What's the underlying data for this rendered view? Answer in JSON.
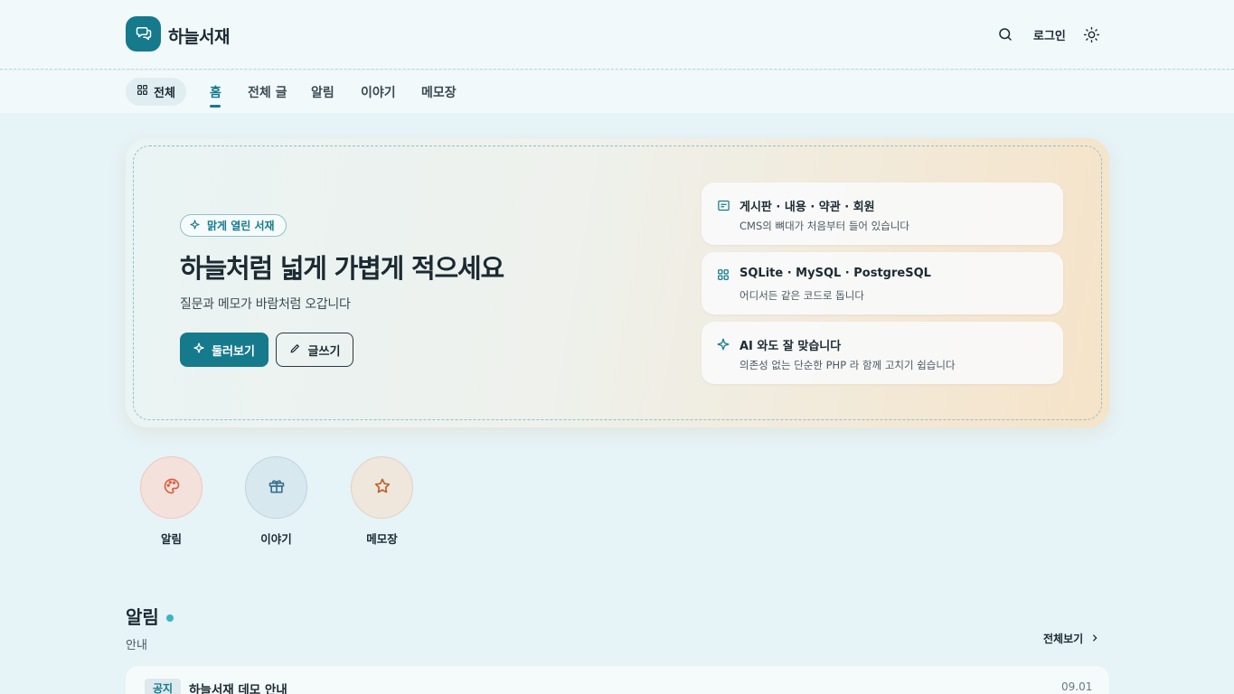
{
  "header": {
    "brand": "하늘서재",
    "login_label": "로그인",
    "icons": {
      "logo": "chat-bubble-icon",
      "search": "search-icon",
      "theme": "sun-icon"
    }
  },
  "nav": {
    "all_label": "전체",
    "items": [
      {
        "label": "홈",
        "active": true
      },
      {
        "label": "전체 글"
      },
      {
        "label": "알림"
      },
      {
        "label": "이야기"
      },
      {
        "label": "메모장"
      }
    ]
  },
  "hero": {
    "tag": "맑게 열린 서재",
    "title": "하늘처럼 넓게 가볍게 적으세요",
    "subtitle": "질문과 메모가 바람처럼 오갑니다",
    "primary_button": "둘러보기",
    "secondary_button": "글쓰기",
    "features": [
      {
        "icon": "board-icon",
        "title": "게시판 · 내용 · 약관 · 회원",
        "desc": "CMS의 뼈대가 처음부터 들어 있습니다"
      },
      {
        "icon": "grid-icon",
        "title": "SQLite · MySQL · PostgreSQL",
        "desc": "어디서든 같은 코드로 돕니다"
      },
      {
        "icon": "sparkle-icon",
        "title": "AI 와도 잘 맞습니다",
        "desc": "의존성 없는 단순한 PHP 라 함께 고치기 쉽습니다"
      }
    ]
  },
  "categories": [
    {
      "label": "알림",
      "icon": "palette-icon",
      "bg": "#f5e1dc",
      "color": "#d9603f"
    },
    {
      "label": "이야기",
      "icon": "gift-icon",
      "bg": "#d8e8ef",
      "color": "#3a6f8f"
    },
    {
      "label": "메모장",
      "icon": "star-icon",
      "bg": "#efe6dc",
      "color": "#b8642c"
    }
  ],
  "section": {
    "title": "알림",
    "subtitle": "안내",
    "see_all": "전체보기",
    "posts": [
      {
        "badge": "공지",
        "title": "하늘서재 데모 안내",
        "date": "09.01"
      }
    ]
  },
  "colors": {
    "accent": "#157a8c",
    "background": "#e6f3f7"
  }
}
